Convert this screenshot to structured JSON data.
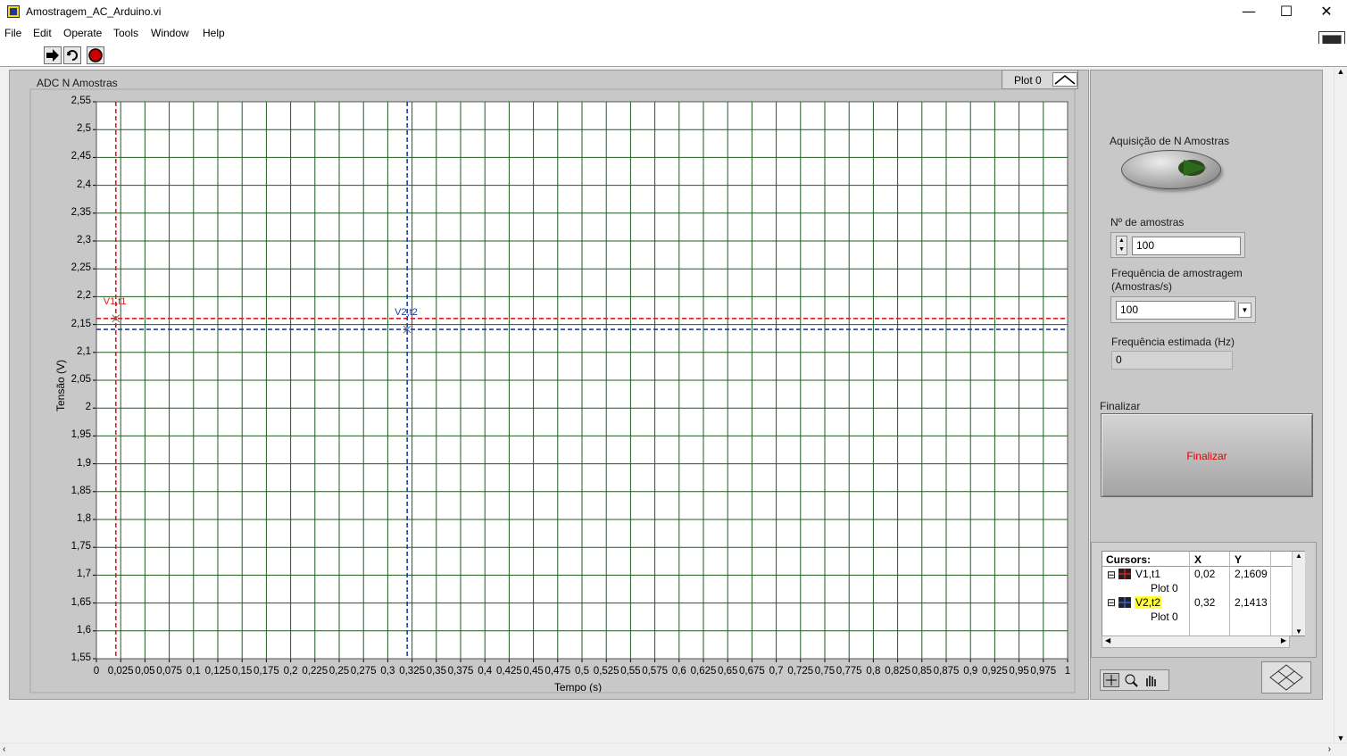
{
  "window": {
    "title": "Amostragem_AC_Arduino.vi",
    "minimize_icon": "minimize-icon",
    "maximize_icon": "maximize-icon",
    "close_icon": "close-icon"
  },
  "menu": [
    "File",
    "Edit",
    "Operate",
    "Tools",
    "Window",
    "Help"
  ],
  "toolbar": {
    "run_icon": "run-arrow-icon",
    "run_continuously_icon": "run-continuously-icon",
    "abort_icon": "abort-stop-icon"
  },
  "graph": {
    "title": "ADC N Amostras",
    "plot_legend": "Plot 0",
    "xlabel": "Tempo (s)",
    "ylabel": "Tensão (V)",
    "y_ticks": [
      "2,55",
      "2,5",
      "2,45",
      "2,4",
      "2,35",
      "2,3",
      "2,25",
      "2,2",
      "2,15",
      "2,1",
      "2,05",
      "2",
      "1,95",
      "1,9",
      "1,85",
      "1,8",
      "1,75",
      "1,7",
      "1,65",
      "1,6",
      "1,55"
    ],
    "x_ticks": [
      "0",
      "0,025",
      "0,05",
      "0,075",
      "0,1",
      "0,125",
      "0,15",
      "0,175",
      "0,2",
      "0,225",
      "0,25",
      "0,275",
      "0,3",
      "0,325",
      "0,35",
      "0,375",
      "0,4",
      "0,425",
      "0,45",
      "0,475",
      "0,5",
      "0,525",
      "0,55",
      "0,575",
      "0,6",
      "0,625",
      "0,65",
      "0,675",
      "0,7",
      "0,725",
      "0,75",
      "0,775",
      "0,8",
      "0,825",
      "0,85",
      "0,875",
      "0,9",
      "0,925",
      "0,95",
      "0,975",
      "1"
    ],
    "background_color": "#ffffff",
    "grid_color": "#1f5b1f",
    "cursors": [
      {
        "name": "V1,t1",
        "x": 0.02,
        "y": 2.1609,
        "color": "#d42020"
      },
      {
        "name": "V2,t2",
        "x": 0.32,
        "y": 2.1413,
        "color": "#1d3f9e"
      }
    ]
  },
  "controls": {
    "acq_label": "Aquisição de N Amostras",
    "n_label": "Nº de amostras",
    "n_value": "100",
    "freq_label_1": "Frequência de amostragem",
    "freq_label_2": "(Amostras/s)",
    "freq_value": "100",
    "est_label": "Frequência estimada (Hz)",
    "est_value": "0",
    "finalizar_label": "Finalizar",
    "finalizar_button": "Finalizar"
  },
  "cursor_table": {
    "headers": [
      "Cursors:",
      "X",
      "Y"
    ],
    "rows": [
      {
        "name": "V1,t1",
        "plot": "Plot 0",
        "x": "0,02",
        "y": "2,1609"
      },
      {
        "name": "V2,t2",
        "plot": "Plot 0",
        "x": "0,32",
        "y": "2,1413"
      }
    ]
  },
  "chart_data": {
    "type": "line",
    "title": "ADC N Amostras",
    "xlabel": "Tempo (s)",
    "ylabel": "Tensão (V)",
    "xlim": [
      0,
      1
    ],
    "ylim": [
      1.55,
      2.55
    ],
    "grid": true,
    "series": []
  }
}
